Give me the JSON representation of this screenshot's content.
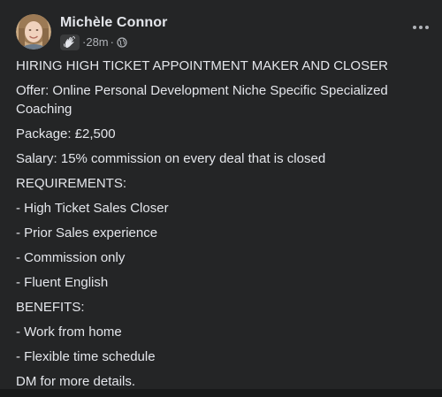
{
  "post": {
    "author": "Michèle Connor",
    "time": "28m",
    "separator": "·",
    "privacy_icon": "globe-icon",
    "badge_icon": "waving-hand-icon",
    "more_icon": "more-options-icon",
    "paragraphs": [
      "HIRING HIGH TICKET APPOINTMENT MAKER AND CLOSER",
      "Offer: Online Personal Development Niche Specific Specialized Coaching",
      "Package: £2,500",
      "Salary: 15% commission on every deal that is closed",
      "REQUIREMENTS:",
      "- High Ticket Sales Closer",
      "- Prior Sales experience",
      "- Commission only",
      "- Fluent English",
      "BENEFITS:",
      "- Work from home",
      "- Flexible time schedule",
      "DM for more details."
    ]
  },
  "colors": {
    "background": "#242526",
    "text_primary": "#e4e6eb",
    "text_secondary": "#b0b3b8"
  }
}
